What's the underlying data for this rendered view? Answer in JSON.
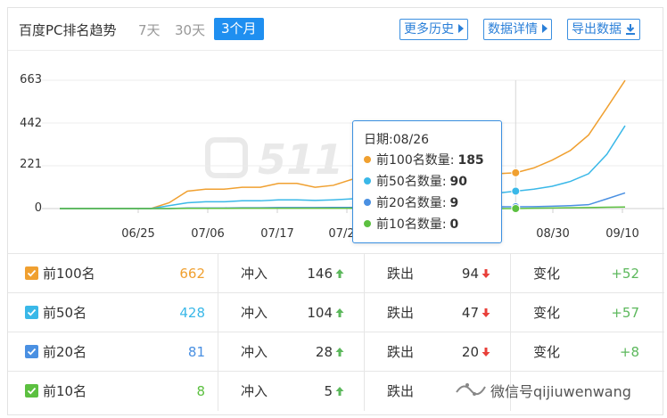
{
  "header": {
    "title": "百度PC排名趋势",
    "tabs": [
      {
        "label": "7天",
        "active": false
      },
      {
        "label": "30天",
        "active": false
      },
      {
        "label": "3个月",
        "active": true
      }
    ],
    "buttons": {
      "more_history": "更多历史",
      "data_details": "数据详情",
      "export_data": "导出数据"
    }
  },
  "chart_data": {
    "type": "line",
    "yticks": [
      "663",
      "442",
      "221",
      "0"
    ],
    "ylim": [
      0,
      663
    ],
    "xticks": [
      "06/25",
      "07/06",
      "07/17",
      "07/2",
      "0",
      "08/30",
      "09/10"
    ],
    "x": [
      "06/13",
      "06/16",
      "06/19",
      "06/22",
      "06/25",
      "06/28",
      "07/01",
      "07/04",
      "07/07",
      "07/10",
      "07/13",
      "07/16",
      "07/19",
      "07/22",
      "07/25",
      "07/28",
      "07/31",
      "08/03",
      "08/06",
      "08/09",
      "08/12",
      "08/15",
      "08/18",
      "08/21",
      "08/24",
      "08/26",
      "08/29",
      "09/01",
      "09/04",
      "09/07",
      "09/10",
      "09/12"
    ],
    "series": [
      {
        "name": "前100名数量",
        "color": "#f0a030",
        "values": [
          0,
          0,
          0,
          0,
          0,
          0,
          30,
          90,
          100,
          100,
          110,
          110,
          130,
          130,
          110,
          120,
          150,
          160,
          155,
          160,
          170,
          170,
          175,
          180,
          180,
          185,
          210,
          250,
          300,
          380,
          520,
          662
        ]
      },
      {
        "name": "前50名数量",
        "color": "#3ab8e8",
        "values": [
          0,
          0,
          0,
          0,
          0,
          0,
          15,
          30,
          35,
          35,
          40,
          40,
          45,
          45,
          42,
          45,
          50,
          55,
          55,
          58,
          60,
          62,
          70,
          75,
          80,
          90,
          100,
          115,
          140,
          180,
          280,
          428
        ]
      },
      {
        "name": "前20名数量",
        "color": "#4a90e2",
        "values": [
          0,
          0,
          0,
          0,
          0,
          0,
          0,
          3,
          3,
          3,
          4,
          4,
          5,
          5,
          5,
          6,
          6,
          7,
          7,
          7,
          8,
          8,
          8,
          8,
          9,
          9,
          10,
          12,
          15,
          20,
          50,
          81
        ]
      },
      {
        "name": "前10名数量",
        "color": "#5cc040",
        "values": [
          0,
          0,
          0,
          0,
          0,
          0,
          0,
          1,
          1,
          1,
          2,
          2,
          2,
          2,
          2,
          2,
          2,
          2,
          3,
          3,
          3,
          3,
          3,
          3,
          0,
          0,
          2,
          3,
          4,
          5,
          7,
          8
        ]
      }
    ],
    "tooltip": {
      "date_label": "日期:08/26",
      "rows": [
        {
          "label": "前100名数量:",
          "value": "185",
          "color": "#f0a030"
        },
        {
          "label": "前50名数量:",
          "value": "90",
          "color": "#3ab8e8"
        },
        {
          "label": "前20名数量:",
          "value": "9",
          "color": "#4a90e2"
        },
        {
          "label": "前10名数量:",
          "value": "0",
          "color": "#5cc040"
        }
      ]
    }
  },
  "table": {
    "rows": [
      {
        "name": "前100名",
        "total": "662",
        "total_color": "#f0a030",
        "checkbox_color": "#f0a030",
        "in_label": "冲入",
        "in_value": "146",
        "out_label": "跌出",
        "out_value": "94",
        "change_label": "变化",
        "change_value": "+52"
      },
      {
        "name": "前50名",
        "total": "428",
        "total_color": "#3ab8e8",
        "checkbox_color": "#3ab8e8",
        "in_label": "冲入",
        "in_value": "104",
        "out_label": "跌出",
        "out_value": "47",
        "change_label": "变化",
        "change_value": "+57"
      },
      {
        "name": "前20名",
        "total": "81",
        "total_color": "#4a90e2",
        "checkbox_color": "#4a90e2",
        "in_label": "冲入",
        "in_value": "28",
        "out_label": "跌出",
        "out_value": "20",
        "change_label": "变化",
        "change_value": "+8"
      },
      {
        "name": "前10名",
        "total": "8",
        "total_color": "#5cc040",
        "checkbox_color": "#5cc040",
        "in_label": "冲入",
        "in_value": "5",
        "out_label": "跌出",
        "out_value": "",
        "change_label": "",
        "change_value": ""
      }
    ]
  },
  "watermark": {
    "text": "微信号qijiuwenwang"
  }
}
